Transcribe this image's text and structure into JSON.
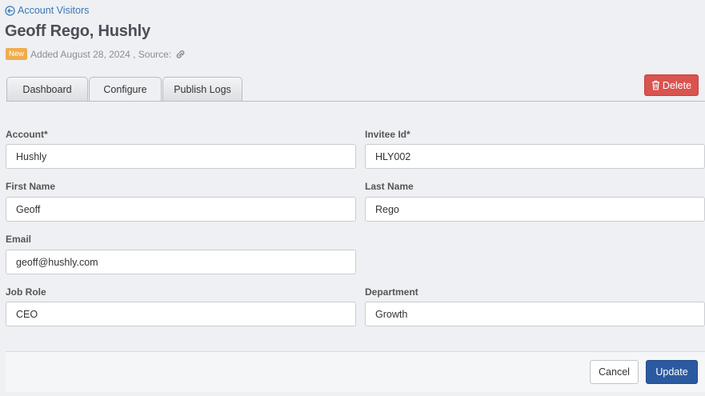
{
  "header": {
    "back_link_label": "Account Visitors",
    "back_icon": "arrow-left-circle-icon",
    "title": "Geoff Rego, Hushly",
    "badge": "New",
    "added_text": "Added August 28, 2024 , Source:",
    "source_icon": "link-icon"
  },
  "tabs": [
    {
      "label": "Dashboard",
      "active": false
    },
    {
      "label": "Configure",
      "active": true
    },
    {
      "label": "Publish Logs",
      "active": false
    }
  ],
  "actions": {
    "delete_label": "Delete",
    "delete_icon": "trash-icon",
    "cancel_label": "Cancel",
    "update_label": "Update"
  },
  "form": {
    "account": {
      "label": "Account*",
      "value": "Hushly"
    },
    "invitee_id": {
      "label": "Invitee Id*",
      "value": "HLY002"
    },
    "first_name": {
      "label": "First Name",
      "value": "Geoff"
    },
    "last_name": {
      "label": "Last Name",
      "value": "Rego"
    },
    "email": {
      "label": "Email",
      "value": "geoff@hushly.com"
    },
    "job_role": {
      "label": "Job Role",
      "value": "CEO"
    },
    "department": {
      "label": "Department",
      "value": "Growth"
    }
  },
  "colors": {
    "link": "#3a78b5",
    "badge": "#f0ad4e",
    "delete": "#d9534f",
    "primary": "#2c5aa0"
  }
}
